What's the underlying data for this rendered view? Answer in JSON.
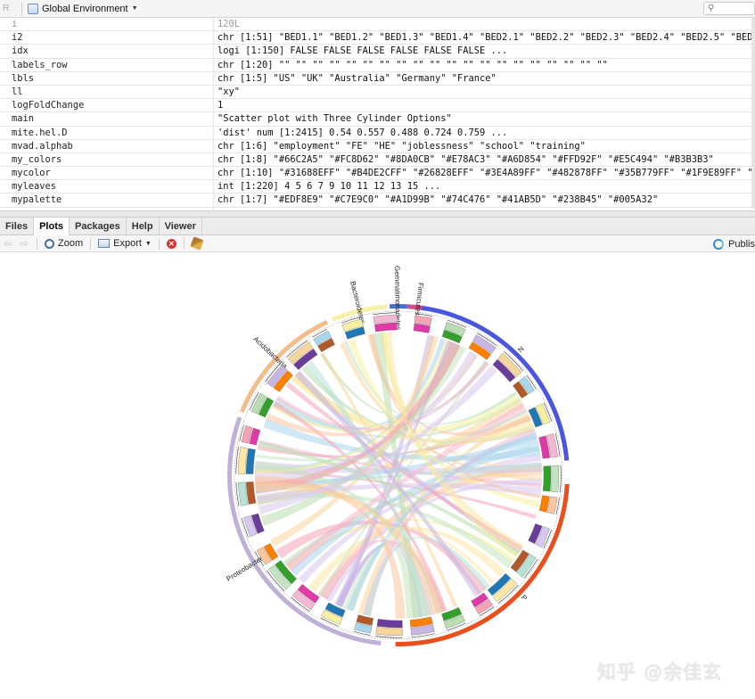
{
  "env_toolbar": {
    "r_label": "R",
    "environment": "Global Environment",
    "search_placeholder": ""
  },
  "environment_rows": [
    {
      "name": "i",
      "value": "120L",
      "faded": true
    },
    {
      "name": "i2",
      "value": "chr [1:51] \"BED1.1\" \"BED1.2\" \"BED1.3\" \"BED1.4\" \"BED2.1\" \"BED2.2\" \"BED2.3\" \"BED2.4\" \"BED2.5\" \"BED3",
      "faded": false
    },
    {
      "name": "idx",
      "value": "logi [1:150] FALSE FALSE FALSE FALSE FALSE FALSE ...",
      "faded": false
    },
    {
      "name": "labels_row",
      "value": "chr [1:20] \"\" \"\" \"\" \"\" \"\" \"\" \"\" \"\" \"\" \"\" \"\" \"\" \"\" \"\" \"\" \"\" \"\" \"\" \"\" \"\"",
      "faded": false
    },
    {
      "name": "lbls",
      "value": "chr [1:5] \"US\" \"UK\" \"Australia\" \"Germany\" \"France\"",
      "faded": false
    },
    {
      "name": "ll",
      "value": "\"xy\"",
      "faded": false
    },
    {
      "name": "logFoldChange",
      "value": "1",
      "faded": false
    },
    {
      "name": "main",
      "value": "\"Scatter plot with Three Cylinder Options\"",
      "faded": false
    },
    {
      "name": "mite.hel.D",
      "value": "'dist' num [1:2415] 0.54 0.557 0.488 0.724 0.759 ...",
      "faded": false
    },
    {
      "name": "mvad.alphab",
      "value": "chr [1:6] \"employment\" \"FE\" \"HE\" \"joblessness\" \"school\" \"training\"",
      "faded": false
    },
    {
      "name": "my_colors",
      "value": "chr [1:8] \"#66C2A5\" \"#FC8D62\" \"#8DA0CB\" \"#E78AC3\" \"#A6D854\" \"#FFD92F\" \"#E5C494\" \"#B3B3B3\"",
      "faded": false
    },
    {
      "name": "mycolor",
      "value": "chr [1:10] \"#31688EFF\" \"#B4DE2CFF\" \"#26828EFF\" \"#3E4A89FF\" \"#482878FF\" \"#35B779FF\" \"#1F9E89FF\" \"#",
      "faded": false
    },
    {
      "name": "myleaves",
      "value": "int [1:220] 4 5 6 7 9 10 11 12 13 15 ...",
      "faded": false
    },
    {
      "name": "mypalette",
      "value": "chr [1:7] \"#EDF8E9\" \"#C7E9C0\" \"#A1D99B\" \"#74C476\" \"#41AB5D\" \"#238B45\" \"#005A32\"",
      "faded": false
    },
    {
      "name": "",
      "value": "",
      "faded": true
    }
  ],
  "tabs": [
    {
      "label": "Files",
      "active": false
    },
    {
      "label": "Plots",
      "active": true
    },
    {
      "label": "Packages",
      "active": false
    },
    {
      "label": "Help",
      "active": false
    },
    {
      "label": "Viewer",
      "active": false
    }
  ],
  "plot_toolbar": {
    "zoom_label": "Zoom",
    "export_label": "Export",
    "publish_label": "Publis"
  },
  "plot": {
    "groups": [
      {
        "label": "N",
        "color": "#4a55e0"
      },
      {
        "label": "P",
        "color": "#e84f1c"
      },
      {
        "label": "Proteobacteria",
        "color": "#bfb0d8"
      },
      {
        "label": "Acidobacteria",
        "color": "#f2bd8a"
      },
      {
        "label": "Bacteroidetes",
        "color": "#f7f0a6"
      },
      {
        "label": "Gemmatimonadetes",
        "color": "#4a6fd0"
      },
      {
        "label": "Firmicutes",
        "color": "#d64a8a"
      }
    ],
    "palette": [
      "#f6a3b6",
      "#b9dcb0",
      "#c7b5e4",
      "#f8d59a",
      "#a9d6ec",
      "#f6f0a0",
      "#f4b7d3",
      "#c4e3c0",
      "#fbc59e",
      "#d8c7ef",
      "#b6e2d6",
      "#fde7a6"
    ]
  },
  "watermark": "知乎 @余佳玄"
}
